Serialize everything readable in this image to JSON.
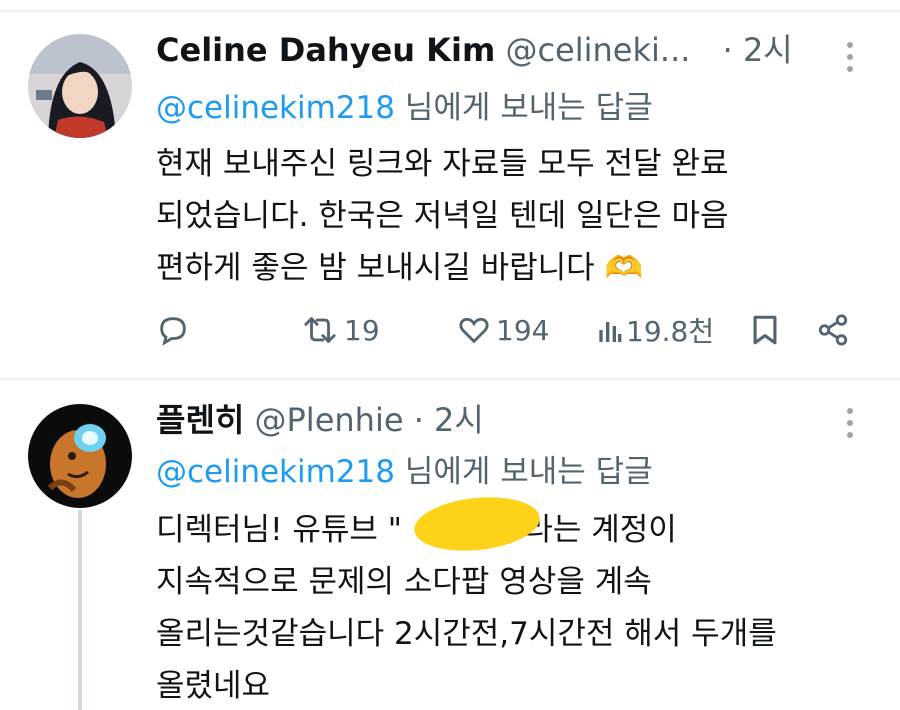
{
  "tweets": [
    {
      "name": "Celine Dahyeu Kim",
      "handle": "@celineki...",
      "dot": "·",
      "time": "2시",
      "reply_mention": "@celinekim218",
      "reply_suffix": " 님에게 보내는 답글",
      "body_lines": [
        "현재 보내주신 링크와 자료들 모두 전달 완료",
        "되었습니다. 한국은 저녁일 텐데 일단은 마음",
        "편하게 좋은 밤 보내시길 바랍니다"
      ],
      "emoji": "🫶",
      "actions": {
        "reply_icon": "reply-icon",
        "retweet_icon": "retweet-icon",
        "retweets": "19",
        "like_icon": "heart-icon",
        "likes": "194",
        "views_icon": "views-icon",
        "views": "19.8천",
        "bookmark_icon": "bookmark-icon",
        "share_icon": "share-icon"
      }
    },
    {
      "name": "플렌히",
      "handle": "@Plenhie",
      "dot": "·",
      "time": "2시",
      "reply_mention": "@celinekim218",
      "reply_suffix": " 님에게 보내는 답글",
      "body_lines": [
        "디렉터님! 유튜브 \"",
        "\"라는 계정이",
        "지속적으로 문제의 소다팝 영상을 계속",
        "올리는것같습니다 2시간전,7시간전 해서 두개를",
        "올렸네요"
      ]
    }
  ],
  "colors": {
    "accent": "#1d9bf0",
    "secondary_text": "#536471",
    "redaction": "#ffd21a"
  }
}
